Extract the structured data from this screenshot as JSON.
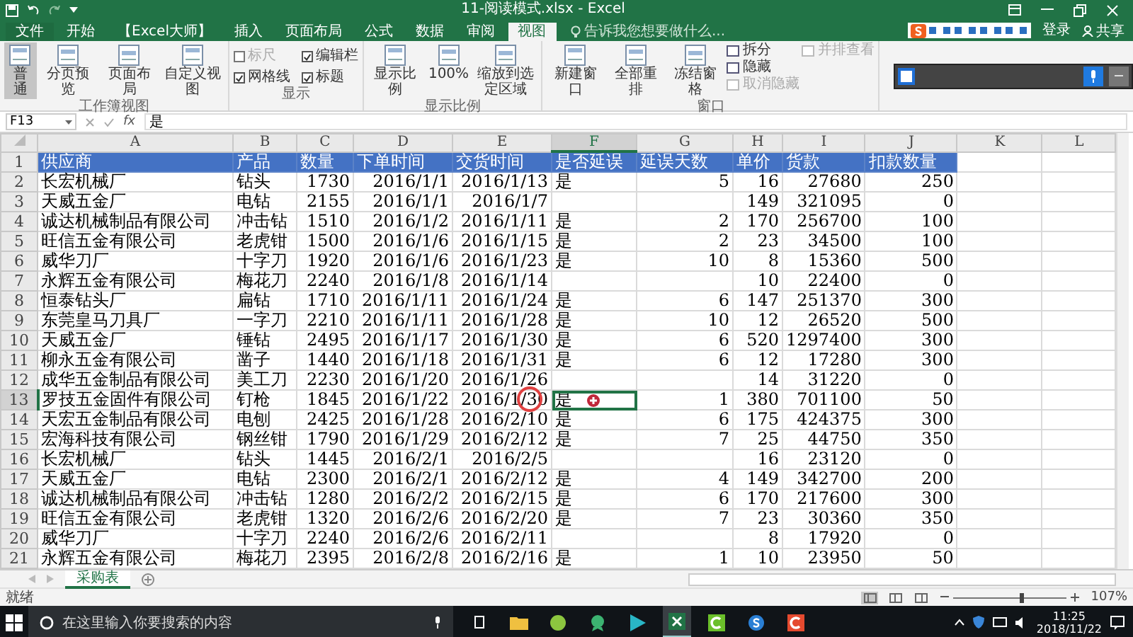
{
  "title_bar": {
    "title": "11-阅读模式.xlsx - Excel"
  },
  "ribbon_tabs": [
    {
      "label": "文件",
      "kind": "file",
      "selected": false
    },
    {
      "label": "开始",
      "kind": "tab",
      "selected": false
    },
    {
      "label": "【Excel大师】",
      "kind": "tab",
      "selected": false
    },
    {
      "label": "插入",
      "kind": "tab",
      "selected": false
    },
    {
      "label": "页面布局",
      "kind": "tab",
      "selected": false
    },
    {
      "label": "公式",
      "kind": "tab",
      "selected": false
    },
    {
      "label": "数据",
      "kind": "tab",
      "selected": false
    },
    {
      "label": "审阅",
      "kind": "tab",
      "selected": false
    },
    {
      "label": "视图",
      "kind": "tab",
      "selected": true
    }
  ],
  "tell_me": {
    "placeholder": "告诉我您想要做什么..."
  },
  "account": {
    "sign_in": "登录",
    "share": "共享"
  },
  "ribbon": {
    "groups": [
      {
        "label": "工作簿视图",
        "items": [
          {
            "kind": "large",
            "label": "普通",
            "selected": true
          },
          {
            "kind": "large",
            "label": "分页预览",
            "selected": false
          },
          {
            "kind": "large",
            "label": "页面布局",
            "selected": false
          },
          {
            "kind": "large",
            "label": "自定义视图",
            "selected": false
          }
        ]
      },
      {
        "label": "显示",
        "items": [
          {
            "kind": "check",
            "label": "标尺",
            "checked": false,
            "disabled": true
          },
          {
            "kind": "check",
            "label": "编辑栏",
            "checked": true,
            "disabled": false
          },
          {
            "kind": "check",
            "label": "网格线",
            "checked": true,
            "disabled": false
          },
          {
            "kind": "check",
            "label": "标题",
            "checked": true,
            "disabled": false
          }
        ]
      },
      {
        "label": "显示比例",
        "items": [
          {
            "kind": "large",
            "label": "显示比例",
            "selected": false
          },
          {
            "kind": "large",
            "label": "100%",
            "selected": false
          },
          {
            "kind": "large",
            "label": "缩放到选定区域",
            "selected": false
          }
        ]
      },
      {
        "label": "窗口",
        "items": [
          {
            "kind": "large",
            "label": "新建窗口",
            "selected": false
          },
          {
            "kind": "large",
            "label": "全部重排",
            "selected": false
          },
          {
            "kind": "large",
            "label": "冻结窗格",
            "selected": false
          },
          {
            "kind": "small",
            "label": "拆分",
            "disabled": false
          },
          {
            "kind": "small",
            "label": "隐藏",
            "disabled": false
          },
          {
            "kind": "small",
            "label": "取消隐藏",
            "disabled": true
          },
          {
            "kind": "small",
            "label": "并排查看",
            "disabled": true
          }
        ]
      }
    ]
  },
  "formula_bar": {
    "name_box": "F13",
    "fx": "fx",
    "value": "是"
  },
  "sheet": {
    "columns": [
      {
        "label": "A",
        "selected": false
      },
      {
        "label": "B",
        "selected": false
      },
      {
        "label": "C",
        "selected": false
      },
      {
        "label": "D",
        "selected": false
      },
      {
        "label": "E",
        "selected": false
      },
      {
        "label": "F",
        "selected": true
      },
      {
        "label": "G",
        "selected": false
      },
      {
        "label": "H",
        "selected": false
      },
      {
        "label": "I",
        "selected": false
      },
      {
        "label": "J",
        "selected": false
      },
      {
        "label": "K",
        "selected": false
      },
      {
        "label": "L",
        "selected": false
      }
    ],
    "rows": [
      {
        "number": "1",
        "kind": "header",
        "selected": false,
        "cells": [
          "供应商",
          "产品",
          "数量",
          "下单时间",
          "交货时间",
          "是否延误",
          "延误天数",
          "单价",
          "货款",
          "扣款数量"
        ]
      },
      {
        "number": "2",
        "kind": "data",
        "selected": false,
        "cells": [
          "长宏机械厂",
          "钻头",
          "1730",
          "2016/1/1",
          "2016/1/13",
          "是",
          "5",
          "16",
          "27680",
          "250"
        ]
      },
      {
        "number": "3",
        "kind": "data",
        "selected": false,
        "cells": [
          "天威五金厂",
          "电钻",
          "2155",
          "2016/1/1",
          "2016/1/7",
          null,
          null,
          "149",
          "321095",
          "0"
        ]
      },
      {
        "number": "4",
        "kind": "data",
        "selected": false,
        "cells": [
          "诚达机械制品有限公司",
          "冲击钻",
          "1510",
          "2016/1/2",
          "2016/1/11",
          "是",
          "2",
          "170",
          "256700",
          "100"
        ]
      },
      {
        "number": "5",
        "kind": "data",
        "selected": false,
        "cells": [
          "旺信五金有限公司",
          "老虎钳",
          "1500",
          "2016/1/6",
          "2016/1/15",
          "是",
          "2",
          "23",
          "34500",
          "100"
        ]
      },
      {
        "number": "6",
        "kind": "data",
        "selected": false,
        "cells": [
          "威华刀厂",
          "十字刀",
          "1920",
          "2016/1/6",
          "2016/1/23",
          "是",
          "10",
          "8",
          "15360",
          "500"
        ]
      },
      {
        "number": "7",
        "kind": "data",
        "selected": false,
        "cells": [
          "永辉五金有限公司",
          "梅花刀",
          "2240",
          "2016/1/8",
          "2016/1/14",
          null,
          null,
          "10",
          "22400",
          "0"
        ]
      },
      {
        "number": "8",
        "kind": "data",
        "selected": false,
        "cells": [
          "恒泰钻头厂",
          "扁钻",
          "1710",
          "2016/1/11",
          "2016/1/24",
          "是",
          "6",
          "147",
          "251370",
          "300"
        ]
      },
      {
        "number": "9",
        "kind": "data",
        "selected": false,
        "cells": [
          "东莞皇马刀具厂",
          "一字刀",
          "2210",
          "2016/1/11",
          "2016/1/28",
          "是",
          "10",
          "12",
          "26520",
          "500"
        ]
      },
      {
        "number": "10",
        "kind": "data",
        "selected": false,
        "cells": [
          "天威五金厂",
          "锤钻",
          "2495",
          "2016/1/17",
          "2016/1/30",
          "是",
          "6",
          "520",
          "1297400",
          "300"
        ]
      },
      {
        "number": "11",
        "kind": "data",
        "selected": false,
        "cells": [
          "柳永五金有限公司",
          "凿子",
          "1440",
          "2016/1/18",
          "2016/1/31",
          "是",
          "6",
          "12",
          "17280",
          "300"
        ]
      },
      {
        "number": "12",
        "kind": "data",
        "selected": false,
        "cells": [
          "成华五金制品有限公司",
          "美工刀",
          "2230",
          "2016/1/20",
          "2016/1/26",
          null,
          null,
          "14",
          "31220",
          "0"
        ]
      },
      {
        "number": "13",
        "kind": "data",
        "selected": true,
        "cells": [
          "罗技五金固件有限公司",
          "钉枪",
          "1845",
          "2016/1/22",
          "2016/1/30",
          "是",
          "1",
          "380",
          "701100",
          "50"
        ]
      },
      {
        "number": "14",
        "kind": "data",
        "selected": false,
        "cells": [
          "天宏五金制品有限公司",
          "电刨",
          "2425",
          "2016/1/28",
          "2016/2/10",
          "是",
          "6",
          "175",
          "424375",
          "300"
        ]
      },
      {
        "number": "15",
        "kind": "data",
        "selected": false,
        "cells": [
          "宏海科技有限公司",
          "钢丝钳",
          "1790",
          "2016/1/29",
          "2016/2/12",
          "是",
          "7",
          "25",
          "44750",
          "350"
        ]
      },
      {
        "number": "16",
        "kind": "data",
        "selected": false,
        "cells": [
          "长宏机械厂",
          "钻头",
          "1445",
          "2016/2/1",
          "2016/2/5",
          null,
          null,
          "16",
          "23120",
          "0"
        ]
      },
      {
        "number": "17",
        "kind": "data",
        "selected": false,
        "cells": [
          "天威五金厂",
          "电钻",
          "2300",
          "2016/2/1",
          "2016/2/12",
          "是",
          "4",
          "149",
          "342700",
          "200"
        ]
      },
      {
        "number": "18",
        "kind": "data",
        "selected": false,
        "cells": [
          "诚达机械制品有限公司",
          "冲击钻",
          "1280",
          "2016/2/2",
          "2016/2/15",
          "是",
          "6",
          "170",
          "217600",
          "300"
        ]
      },
      {
        "number": "19",
        "kind": "data",
        "selected": false,
        "cells": [
          "旺信五金有限公司",
          "老虎钳",
          "1320",
          "2016/2/6",
          "2016/2/20",
          "是",
          "7",
          "23",
          "30360",
          "350"
        ]
      },
      {
        "number": "20",
        "kind": "data",
        "selected": false,
        "cells": [
          "威华刀厂",
          "十字刀",
          "2240",
          "2016/2/6",
          "2016/2/11",
          null,
          null,
          "8",
          "17920",
          "0"
        ]
      },
      {
        "number": "21",
        "kind": "data",
        "selected": false,
        "cells": [
          "永辉五金有限公司",
          "梅花刀",
          "2395",
          "2016/2/8",
          "2016/2/16",
          "是",
          "1",
          "10",
          "23950",
          "50"
        ]
      }
    ]
  },
  "sheet_tabs": [
    {
      "label": "采购表",
      "selected": true
    }
  ],
  "status_bar": {
    "status": "就绪",
    "views": [
      {
        "selected": true
      },
      {
        "selected": false
      },
      {
        "selected": false
      }
    ],
    "zoom_slider": {
      "level": 0.58
    },
    "zoom": "107%"
  },
  "taskbar": {
    "search_placeholder": "在这里输入你要搜索的内容",
    "time": "11:25",
    "date": "2018/11/22"
  }
}
